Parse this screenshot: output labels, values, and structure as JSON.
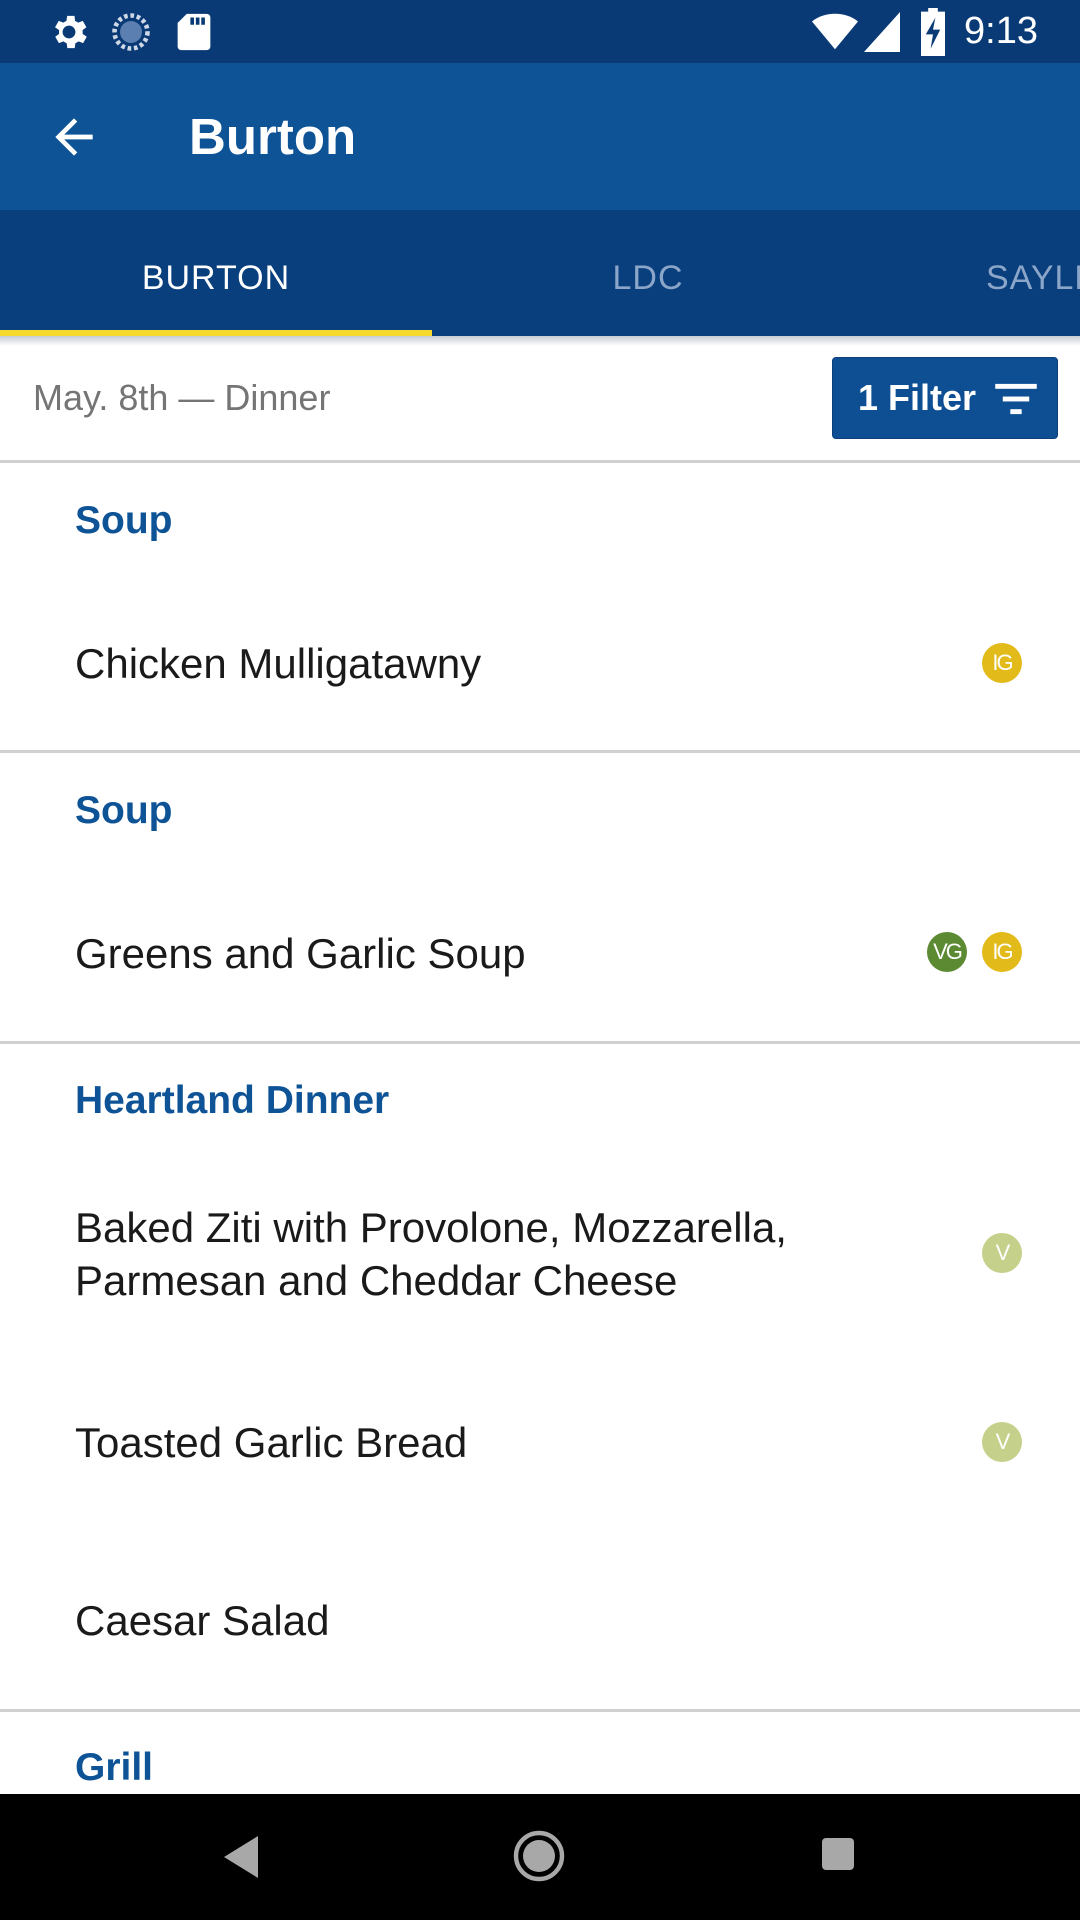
{
  "status_bar": {
    "time": "9:13",
    "left_icons": [
      "settings-icon",
      "sync-icon",
      "sd-card-icon"
    ],
    "right_icons": [
      "wifi-icon",
      "signal-icon",
      "battery-charging-icon"
    ]
  },
  "app_bar": {
    "title": "Burton",
    "back_icon": "arrow-back-icon"
  },
  "tabs": [
    {
      "label": "BURTON",
      "active": true
    },
    {
      "label": "LDC",
      "active": false
    },
    {
      "label": "SAYLES",
      "active": false
    }
  ],
  "date_bar": {
    "date_text": "May. 8th — Dinner",
    "filter_label": "1 Filter",
    "filter_icon": "filter-icon"
  },
  "colors": {
    "header": "#0e5396",
    "tab_bar": "#093f7d",
    "indicator": "#f5d92e"
  },
  "badge_styles": {
    "IG": {
      "color": "#e2bb1a",
      "text_color": "#ffffff"
    },
    "VG": {
      "color": "#5b8a32",
      "text_color": "#ffffff"
    },
    "V": {
      "color": "#c5d08a",
      "text_color": "#ffffff"
    }
  },
  "menu": [
    {
      "station": "Soup",
      "items": [
        {
          "name": "Chicken Mulligatawny",
          "badges": [
            "IG"
          ]
        }
      ]
    },
    {
      "station": "Soup",
      "items": [
        {
          "name": "Greens and Garlic Soup",
          "badges": [
            "VG",
            "IG"
          ]
        }
      ]
    },
    {
      "station": "Heartland Dinner",
      "items": [
        {
          "name": "Baked Ziti with Provolone, Mozzarella, Parmesan and Cheddar Cheese",
          "badges": [
            "V"
          ]
        },
        {
          "name": "Toasted Garlic Bread",
          "badges": [
            "V"
          ]
        },
        {
          "name": "Caesar Salad",
          "badges": []
        }
      ]
    },
    {
      "station": "Grill",
      "items": []
    }
  ],
  "nav_bar": {
    "buttons": [
      "back-triangle-icon",
      "home-circle-icon",
      "recents-square-icon"
    ]
  }
}
